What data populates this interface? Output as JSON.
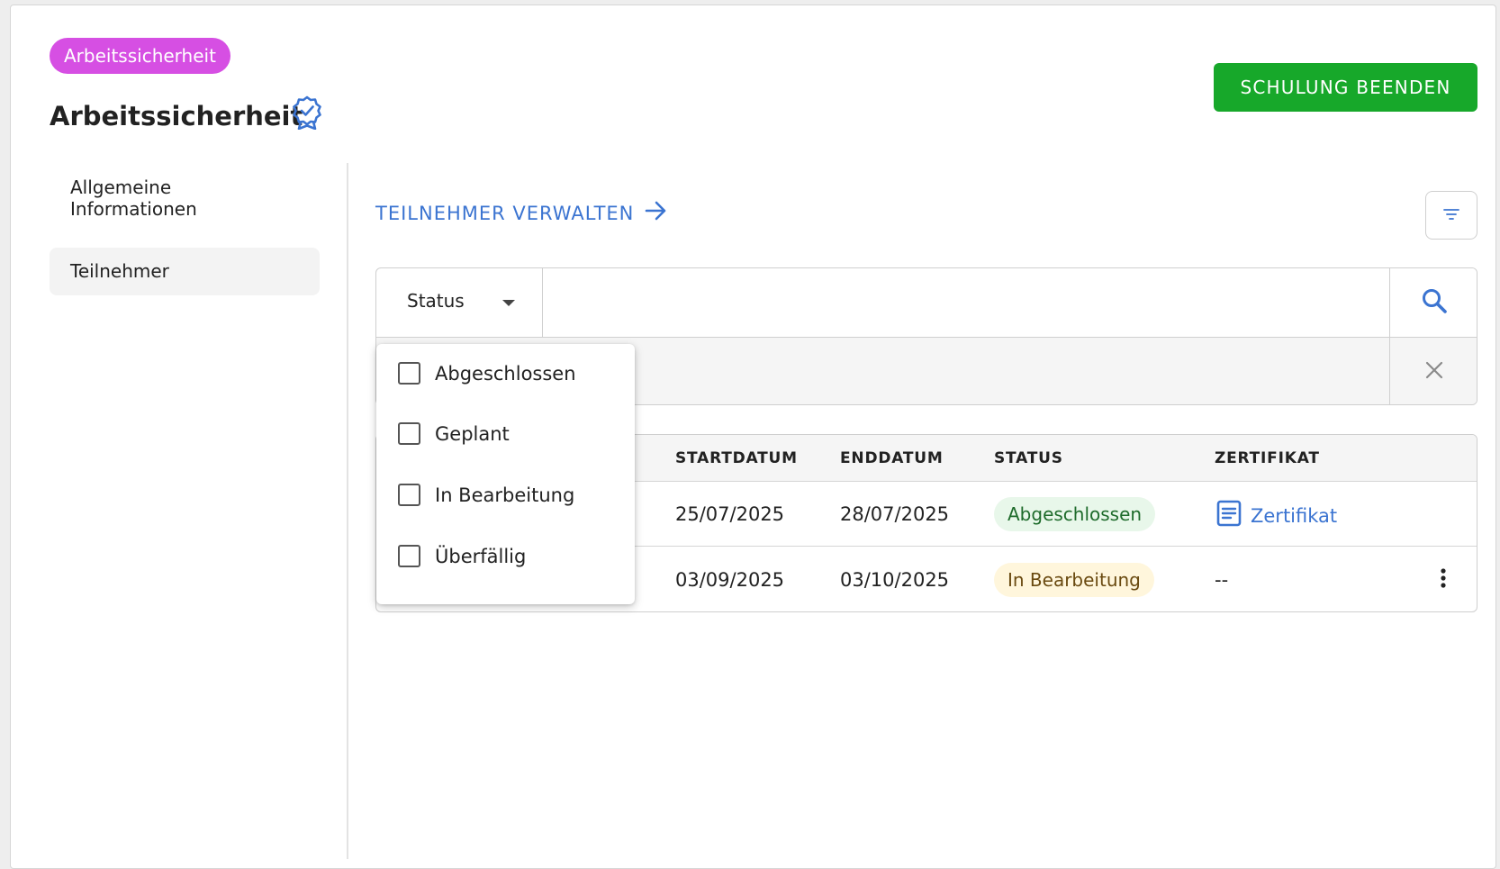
{
  "header": {
    "category_badge": "Arbeitssicherheit",
    "title": "Arbeitssicherheit",
    "title_icon": "award-badge-icon",
    "end_button": "SCHULUNG BEENDEN"
  },
  "sidebar": {
    "items": [
      {
        "label": "Allgemeine Informationen",
        "active": false
      },
      {
        "label": "Teilnehmer",
        "active": true
      }
    ]
  },
  "main": {
    "manage_link": "TEILNEHMER VERWALTEN",
    "filter_icon": "filter-icon",
    "search": {
      "status_label": "Status",
      "query": "",
      "search_icon": "search-icon",
      "clear_icon": "close-icon"
    },
    "status_options": [
      {
        "label": "Abgeschlossen",
        "checked": false
      },
      {
        "label": "Geplant",
        "checked": false
      },
      {
        "label": "In Bearbeitung",
        "checked": false
      },
      {
        "label": "Überfällig",
        "checked": false
      }
    ],
    "table": {
      "columns": [
        "STARTDATUM",
        "ENDDATUM",
        "STATUS",
        "ZERTIFIKAT"
      ],
      "rows": [
        {
          "start": "25/07/2025",
          "end": "28/07/2025",
          "status": "Abgeschlossen",
          "status_color": "#e8f7ea",
          "certificate": "Zertifikat"
        },
        {
          "start": "03/09/2025",
          "end": "03/10/2025",
          "status": "In Bearbeitung",
          "status_color": "#fff6dc",
          "certificate": "--"
        }
      ]
    }
  },
  "colors": {
    "badge": "#d64fe3",
    "primary_action": "#17a82a",
    "link": "#3b74d1"
  }
}
